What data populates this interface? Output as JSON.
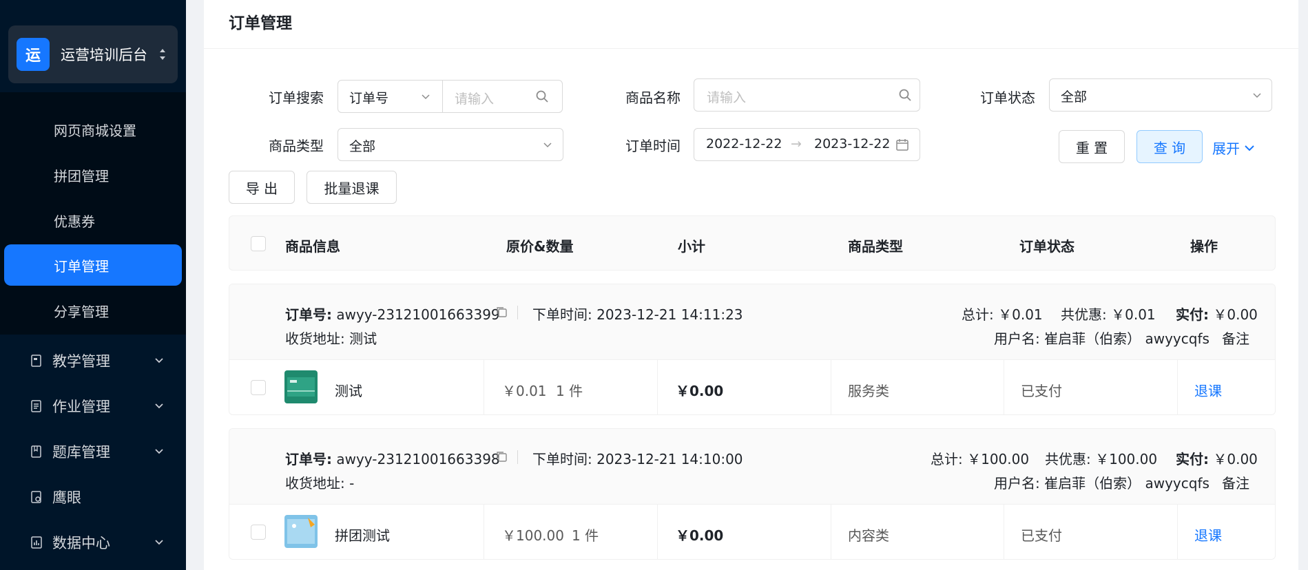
{
  "sidebar": {
    "brand": {
      "logo_char": "运",
      "title": "运营培训后台"
    },
    "submenu": [
      {
        "label": "网页商城设置",
        "active": false
      },
      {
        "label": "拼团管理",
        "active": false
      },
      {
        "label": "优惠券",
        "active": false
      },
      {
        "label": "订单管理",
        "active": true
      },
      {
        "label": "分享管理",
        "active": false
      }
    ],
    "menu": [
      {
        "label": "教学管理",
        "icon": "book-icon",
        "has_children": true
      },
      {
        "label": "作业管理",
        "icon": "homework-icon",
        "has_children": true
      },
      {
        "label": "题库管理",
        "icon": "question-bank-icon",
        "has_children": true
      },
      {
        "label": "鹰眼",
        "icon": "eye-icon",
        "has_children": false
      },
      {
        "label": "数据中心",
        "icon": "chart-icon",
        "has_children": true
      }
    ]
  },
  "page": {
    "title": "订单管理"
  },
  "filters": {
    "order_search_label": "订单搜索",
    "order_search_type": "订单号",
    "order_search_placeholder": "请输入",
    "product_name_label": "商品名称",
    "product_name_placeholder": "请输入",
    "order_status_label": "订单状态",
    "order_status_value": "全部",
    "product_type_label": "商品类型",
    "product_type_value": "全部",
    "order_time_label": "订单时间",
    "date_start": "2022-12-22",
    "date_arrow": "→",
    "date_end": "2023-12-22",
    "reset_label": "重 置",
    "query_label": "查 询",
    "expand_label": "展开"
  },
  "actions": {
    "export_label": "导 出",
    "batch_refund_label": "批量退课"
  },
  "table": {
    "headers": [
      "商品信息",
      "原价&数量",
      "小计",
      "商品类型",
      "订单状态",
      "操作"
    ]
  },
  "orders": [
    {
      "order_no_label": "订单号:",
      "order_no": "awyy-23121001663399",
      "time_label": "下单时间:",
      "time": "2023-12-21 14:11:23",
      "address_label": "收货地址:",
      "address": "测试",
      "total_label": "总计:",
      "total": "￥0.01",
      "discount_label": "共优惠:",
      "discount": "￥0.01",
      "paid_label": "实付:",
      "paid": "￥0.00",
      "user_label": "用户名:",
      "user": "崔启菲（伯索） awyycqfs",
      "remark_label": "备注",
      "item_name": "测试",
      "price": "￥0.01",
      "qty": "1 件",
      "subtotal": "￥0.00",
      "type": "服务类",
      "status": "已支付",
      "action": "退课",
      "thumb_color": "#1f8a6e"
    },
    {
      "order_no_label": "订单号:",
      "order_no": "awyy-23121001663398",
      "time_label": "下单时间:",
      "time": "2023-12-21 14:10:00",
      "address_label": "收货地址:",
      "address": "-",
      "total_label": "总计:",
      "total": "￥100.00",
      "discount_label": "共优惠:",
      "discount": "￥100.00",
      "paid_label": "实付:",
      "paid": "￥0.00",
      "user_label": "用户名:",
      "user": "崔启菲（伯索） awyycqfs",
      "remark_label": "备注",
      "item_name": "拼团测试",
      "price": "￥100.00",
      "qty": "1 件",
      "subtotal": "￥0.00",
      "type": "内容类",
      "status": "已支付",
      "action": "退课",
      "thumb_color": "#7fc3e8"
    }
  ],
  "colors": {
    "primary": "#1677ff",
    "sidebar_bg": "#001529",
    "submenu_bg": "#000c17"
  }
}
